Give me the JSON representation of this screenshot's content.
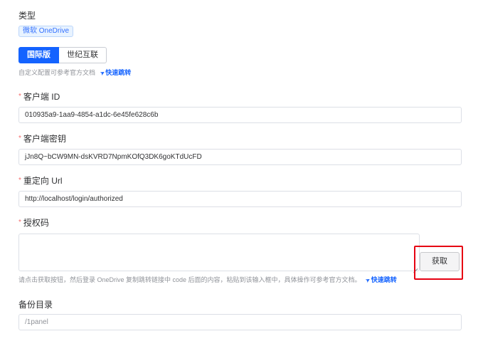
{
  "type": {
    "label": "类型",
    "tag": "微软 OneDrive"
  },
  "region": {
    "options": [
      "国际版",
      "世纪互联"
    ],
    "selected": "国际版"
  },
  "region_hint": {
    "text": "自定义配置可参考官方文档",
    "link": "快速跳转"
  },
  "client_id": {
    "label": "客户端 ID",
    "value": "010935a9-1aa9-4854-a1dc-6e45fe628c6b"
  },
  "client_secret": {
    "label": "客户端密钥",
    "value": "jJn8Q~bCW9MN-dsKVRD7NpmKOfQ3DK6goKTdUcFD"
  },
  "redirect_url": {
    "label": "重定向 Url",
    "value": "http://localhost/login/authorized"
  },
  "auth_code": {
    "label": "授权码",
    "value": "",
    "button": "获取",
    "hint": "请点击获取按钮，然后登录 OneDrive 复制跳转链接中 code 后面的内容，粘贴到该输入框中，具体操作可参考官方文档。",
    "link": "快速跳转"
  },
  "backup_dir": {
    "label": "备份目录",
    "placeholder": "/1panel"
  },
  "colors": {
    "primary": "#1463ff",
    "required": "#f56c6c",
    "highlight": "#e60012"
  }
}
